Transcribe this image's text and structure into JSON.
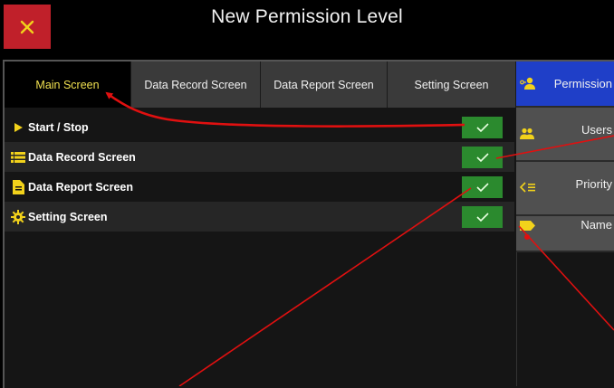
{
  "header": {
    "title": "New Permission Level"
  },
  "tabs": [
    {
      "label": "Main Screen",
      "active": true
    },
    {
      "label": "Data Record Screen",
      "active": false
    },
    {
      "label": "Data Report Screen",
      "active": false
    },
    {
      "label": "Setting Screen",
      "active": false
    }
  ],
  "permissions": [
    {
      "label": "Start / Stop",
      "icon": "play-icon",
      "enabled": true
    },
    {
      "label": "Data Record Screen",
      "icon": "list-icon",
      "enabled": true
    },
    {
      "label": "Data Report Screen",
      "icon": "document-icon",
      "enabled": true
    },
    {
      "label": "Setting Screen",
      "icon": "gear-icon",
      "enabled": true
    }
  ],
  "sidebar": {
    "items": [
      {
        "label": "Permission",
        "icon": "user-key-icon",
        "active": true
      },
      {
        "label": "Users",
        "icon": "users-icon",
        "active": false
      },
      {
        "label": "Priority",
        "icon": "priority-icon",
        "active": false
      },
      {
        "label": "Name",
        "icon": "tag-icon",
        "active": false
      }
    ]
  },
  "colors": {
    "close": "#c0202a",
    "active_tab_text": "#f0e050",
    "check": "#2b8a2e",
    "sidebar_active": "#1f3fc8",
    "annotation": "#e01010",
    "icon_yellow": "#f2d21b"
  }
}
